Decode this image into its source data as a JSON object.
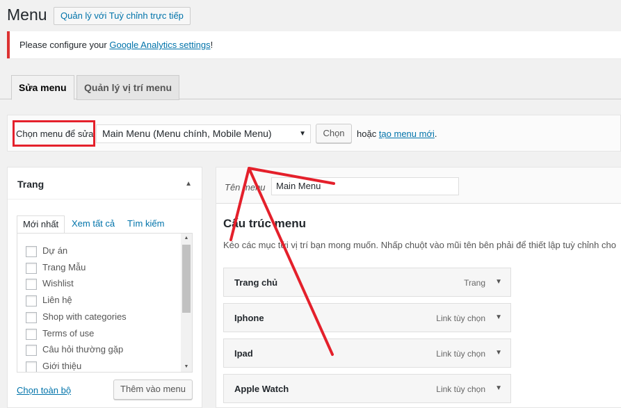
{
  "header": {
    "title": "Menu",
    "action_button": "Quản lý với Tuỳ chỉnh trực tiếp"
  },
  "notice": {
    "text_before": "Please configure your ",
    "link": "Google Analytics settings",
    "text_after": "!"
  },
  "tabs": [
    {
      "label": "Sửa menu"
    },
    {
      "label": "Quản lý vị trí menu"
    }
  ],
  "manage": {
    "label": "Chọn menu để sửa:",
    "selected": "Main Menu (Menu chính, Mobile Menu)",
    "choose_button": "Chọn",
    "or_text": "hoặc ",
    "create_link": "tạo menu mới",
    "period": "."
  },
  "left_panel": {
    "title": "Trang",
    "sub_tabs": [
      {
        "label": "Mới nhất"
      },
      {
        "label": "Xem tất cả"
      },
      {
        "label": "Tìm kiếm"
      }
    ],
    "items": [
      {
        "label": "Dự án"
      },
      {
        "label": "Trang Mẫu"
      },
      {
        "label": "Wishlist"
      },
      {
        "label": "Liên hệ"
      },
      {
        "label": "Shop with categories"
      },
      {
        "label": "Terms of use"
      },
      {
        "label": "Câu hỏi thường gặp"
      },
      {
        "label": "Giới thiệu"
      }
    ],
    "select_all": "Chọn toàn bộ",
    "add_button": "Thêm vào menu"
  },
  "right_panel": {
    "name_label": "Tên menu",
    "name_value": "Main Menu",
    "structure_title": "Cấu trúc menu",
    "structure_desc": "Kéo các mục tới vị trí bạn mong muốn. Nhấp chuột vào mũi tên bên phải để thiết lập tuỳ chỉnh cho",
    "menu_items": [
      {
        "title": "Trang chủ",
        "type": "Trang"
      },
      {
        "title": "Iphone",
        "type": "Link tùy chọn"
      },
      {
        "title": "Ipad",
        "type": "Link tùy chọn"
      },
      {
        "title": "Apple Watch",
        "type": "Link tùy chọn"
      }
    ]
  },
  "annotation": {
    "color": "#e4202b"
  },
  "colors": {
    "link": "#0073aa",
    "notice_border": "#dc3232",
    "background": "#f1f1f1"
  }
}
